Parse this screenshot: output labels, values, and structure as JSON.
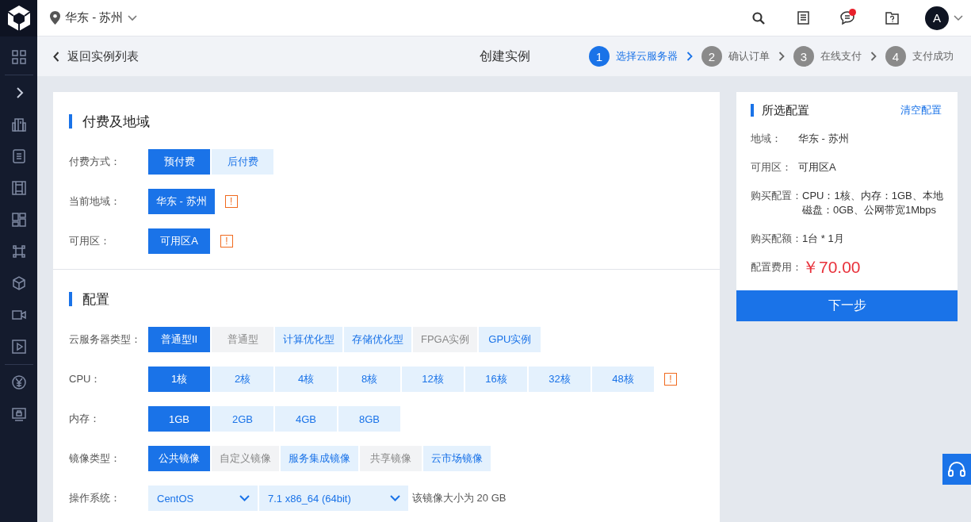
{
  "topbar": {
    "region": "华东 - 苏州",
    "avatar": "A",
    "unread": true
  },
  "subheader": {
    "back": "返回实例列表",
    "title": "创建实例",
    "steps": [
      {
        "number": "1",
        "label": "选择云服务器",
        "selected": true
      },
      {
        "number": "2",
        "label": "确认订单",
        "selected": false
      },
      {
        "number": "3",
        "label": "在线支付",
        "selected": false
      },
      {
        "number": "4",
        "label": "支付成功",
        "selected": false
      }
    ]
  },
  "sections": [
    {
      "title": "付费及地域",
      "rows": [
        {
          "label": "付费方式：",
          "kind": "options",
          "options": [
            {
              "label": "预付费",
              "selected": true
            },
            {
              "label": "后付费",
              "selected": false,
              "disabled": false
            }
          ]
        },
        {
          "label": "当前地域：",
          "kind": "options",
          "warning": "!",
          "options": [
            {
              "label": "华东 - 苏州",
              "selected": true
            }
          ]
        },
        {
          "label": "可用区：",
          "kind": "options",
          "warning": "!",
          "options": [
            {
              "label": "可用区A",
              "selected": true
            }
          ]
        }
      ]
    },
    {
      "title": "配置",
      "rows": [
        {
          "label": "云服务器类型：",
          "kind": "options",
          "options": [
            {
              "label": "普通型II",
              "selected": true
            },
            {
              "label": "普通型",
              "selected": false,
              "disabled": true
            },
            {
              "label": "计算优化型",
              "selected": false,
              "disabled": false
            },
            {
              "label": "存储优化型",
              "selected": false,
              "disabled": false
            },
            {
              "label": "FPGA实例",
              "selected": false,
              "disabled": true
            },
            {
              "label": "GPU实例",
              "selected": false,
              "disabled": false
            }
          ]
        },
        {
          "label": "CPU：",
          "kind": "options",
          "warning": "!",
          "options": [
            {
              "label": "1核",
              "selected": true
            },
            {
              "label": "2核",
              "selected": false,
              "disabled": false
            },
            {
              "label": "4核",
              "selected": false,
              "disabled": false
            },
            {
              "label": "8核",
              "selected": false,
              "disabled": false
            },
            {
              "label": "12核",
              "selected": false,
              "disabled": false
            },
            {
              "label": "16核",
              "selected": false,
              "disabled": false
            },
            {
              "label": "32核",
              "selected": false,
              "disabled": false
            },
            {
              "label": "48核",
              "selected": false,
              "disabled": false
            }
          ]
        },
        {
          "label": "内存：",
          "kind": "options",
          "options": [
            {
              "label": "1GB",
              "selected": true
            },
            {
              "label": "2GB",
              "selected": false,
              "disabled": false
            },
            {
              "label": "4GB",
              "selected": false,
              "disabled": false
            },
            {
              "label": "8GB",
              "selected": false,
              "disabled": false
            }
          ]
        },
        {
          "label": "镜像类型：",
          "kind": "options",
          "options": [
            {
              "label": "公共镜像",
              "selected": true
            },
            {
              "label": "自定义镜像",
              "selected": false,
              "disabled": true
            },
            {
              "label": "服务集成镜像",
              "selected": false,
              "disabled": false
            },
            {
              "label": "共享镜像",
              "selected": false,
              "disabled": true
            },
            {
              "label": "云市场镜像",
              "selected": false,
              "disabled": false
            }
          ]
        },
        {
          "label": "操作系统：",
          "kind": "selects",
          "selects": [
            {
              "value": "CentOS"
            },
            {
              "value": "7.1 x86_64 (64bit)"
            }
          ],
          "note": "该镜像大小为 20 GB"
        }
      ]
    }
  ],
  "summary": {
    "title": "所选配置",
    "clear": "清空配置",
    "fields": [
      {
        "label": "地域：",
        "value": "华东 - 苏州"
      },
      {
        "label": "可用区：",
        "value": "可用区A"
      },
      {
        "label": "购买配置：",
        "value": "CPU：1核、内存：1GB、本地磁盘：0GB、公网带宽1Mbps"
      },
      {
        "label": "购买配额：",
        "value": "1台 * 1月"
      }
    ],
    "price_label": "配置费用：",
    "price": "￥70.00",
    "next": "下一步"
  }
}
